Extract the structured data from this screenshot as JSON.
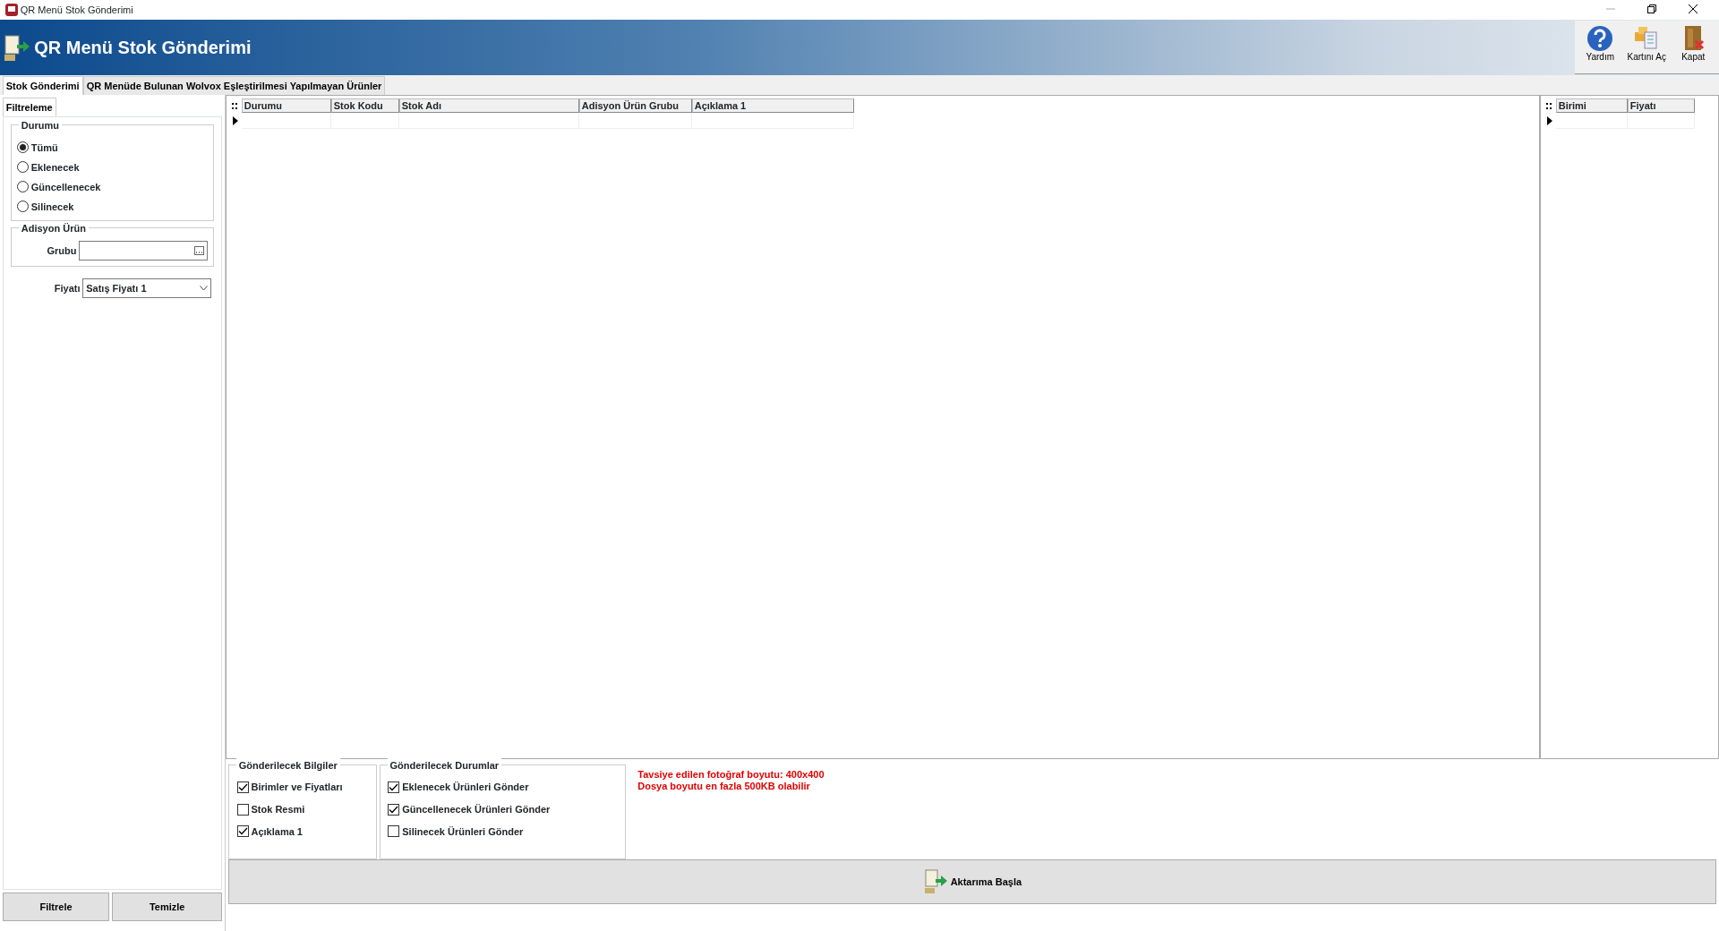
{
  "window": {
    "title": "QR Menü Stok Gönderimi"
  },
  "header": {
    "title": "QR Menü Stok Gönderimi"
  },
  "toolbar": [
    {
      "kind": "help",
      "label": "Yardım"
    },
    {
      "kind": "card",
      "label": "Kartını Aç"
    },
    {
      "kind": "close",
      "label": "Kapat"
    }
  ],
  "tabs": [
    {
      "label": "Stok Gönderimi",
      "selected": true
    },
    {
      "label": "QR Menüde Bulunan Wolvox Eşleştirilmesi Yapılmayan Ürünler",
      "selected": false
    }
  ],
  "filter": {
    "tab_label": "Filtreleme",
    "status_group": {
      "title": "Durumu",
      "options": [
        {
          "label": "Tümü",
          "selected": true
        },
        {
          "label": "Eklenecek",
          "selected": false
        },
        {
          "label": "Güncellenecek",
          "selected": false
        },
        {
          "label": "Silinecek",
          "selected": false
        }
      ]
    },
    "product_group": {
      "title": "Adisyon Ürün",
      "field_label": "Grubu"
    },
    "price": {
      "label": "Fiyatı",
      "value": "Satış Fiyatı 1"
    },
    "buttons": [
      "Filtrele",
      "Temizle"
    ]
  },
  "grid": {
    "columns": [
      "Durumu",
      "Stok Kodu",
      "Stok Adı",
      "Adisyon Ürün Grubu",
      "Açıklama 1"
    ]
  },
  "unit_grid": {
    "columns": [
      "Birimi",
      "Fiyatı"
    ]
  },
  "send_info": {
    "title": "Gönderilecek Bilgiler",
    "options": [
      {
        "label": "Birimler ve Fiyatları",
        "checked": true
      },
      {
        "label": "Stok Resmi",
        "checked": false
      },
      {
        "label": "Açıklama 1",
        "checked": true
      }
    ]
  },
  "send_states": {
    "title": "Gönderilecek Durumlar",
    "options": [
      {
        "label": "Eklenecek Ürünleri Gönder",
        "checked": true
      },
      {
        "label": "Güncellenecek Ürünleri Gönder",
        "checked": true
      },
      {
        "label": "Silinecek Ürünleri Gönder",
        "checked": false
      }
    ]
  },
  "notice": [
    "Tavsiye edilen fotoğraf boyutu: 400x400",
    "Dosya boyutu en fazla 500KB olabilir"
  ],
  "action_button": {
    "label": "Aktarıma Başla"
  }
}
